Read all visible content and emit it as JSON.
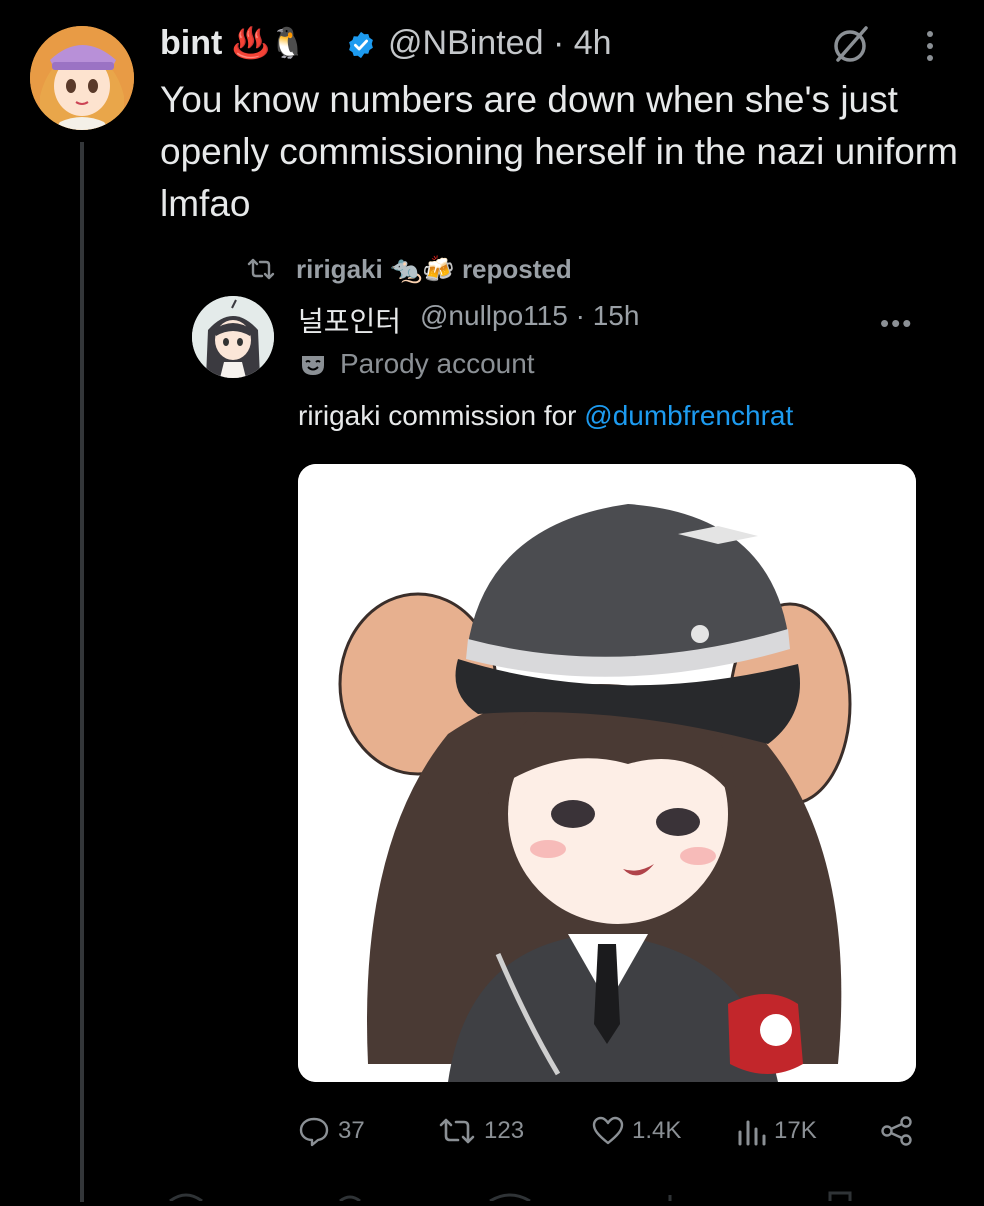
{
  "main_tweet": {
    "display_name": "bint",
    "name_emojis": "♨️🐧",
    "handle": "@NBinted",
    "time_sep": "·",
    "time": "4h",
    "text": "You know numbers are down when she's just openly commissioning herself in the nazi uniform lmfao"
  },
  "repost": {
    "reposter": "ririgaki",
    "reposter_emojis": "🐀🍻",
    "label": "reposted"
  },
  "inner_tweet": {
    "display_name": "널포인터",
    "handle": "@nullpo115",
    "time_sep": "·",
    "time": "15h",
    "more_label": "•••",
    "badge_label": "Parody account",
    "text_prefix": "ririgaki commission for ",
    "mention": "@dumbfrenchrat"
  },
  "actions": {
    "replies": "37",
    "reposts": "123",
    "likes": "1.4K",
    "views": "17K"
  },
  "colors": {
    "background": "#000000",
    "text": "#e7e9ea",
    "muted": "#8b9095",
    "link": "#1d9bf0",
    "verified": "#1d9bf0"
  },
  "icons": [
    "verified-badge-icon",
    "grok-icon",
    "more-vertical-icon",
    "repost-icon",
    "parody-mask-icon",
    "more-horizontal-icon",
    "reply-icon",
    "like-icon",
    "views-icon",
    "share-icon"
  ]
}
